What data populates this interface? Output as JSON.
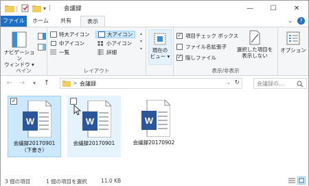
{
  "window": {
    "title": "会議録",
    "minimize": "—",
    "maximize": "☐",
    "close": "✕"
  },
  "tabs": {
    "file": "ファイル",
    "home": "ホーム",
    "share": "共有",
    "view": "表示"
  },
  "ribbon": {
    "pane": {
      "nav_pane_line1": "ナビゲーション",
      "nav_pane_line2": "ウィンドウ ▾",
      "group": "ペイン"
    },
    "layout": {
      "group": "レイアウト",
      "items": [
        "特大アイコン",
        "大アイコン",
        "中アイコン",
        "小アイコン",
        "一覧",
        "詳細"
      ],
      "selected": "大アイコン"
    },
    "current_view": {
      "line1": "現在の",
      "line2": "ビュー ▾"
    },
    "show_hide": {
      "group": "表示/非表示",
      "item_checkboxes": "項目チェック ボックス",
      "file_extensions": "ファイル名拡張子",
      "hidden_items": "隠しファイル",
      "hide_selected_line1": "選択した項目を",
      "hide_selected_line2": "表示しない"
    },
    "options": "オプション"
  },
  "address": {
    "back": "←",
    "forward": "→",
    "recent": "▾",
    "up": "↑",
    "sep": ">",
    "path": "会議録",
    "refresh": "↻",
    "search_placeholder": "会議録の..."
  },
  "files": [
    {
      "name_line1": "会議録20170901",
      "name_line2": "（下書き）",
      "checked": true
    },
    {
      "name_line1": "会議録20170901",
      "name_line2": "",
      "checked": false
    },
    {
      "name_line1": "会議録20170902",
      "name_line2": "",
      "checked": false
    }
  ],
  "status": {
    "count": "3 個の項目",
    "selection": "1 個の項目を選択",
    "size": "11.0 KB"
  },
  "colors": {
    "accent": "#1e6fc6",
    "word": "#2b579a",
    "selection": "#cce8ff"
  }
}
